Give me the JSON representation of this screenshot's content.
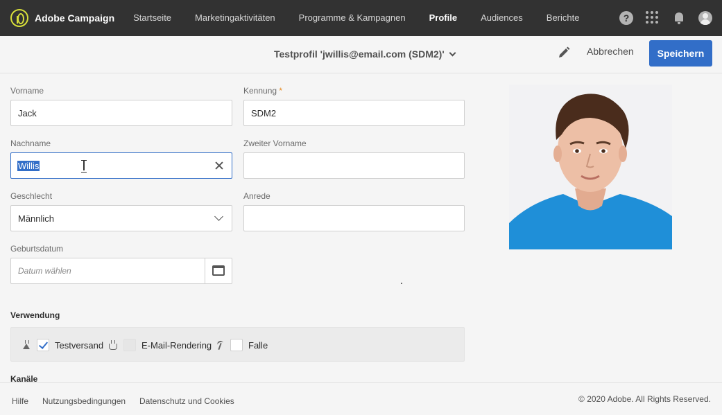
{
  "app": {
    "name": "Adobe Campaign"
  },
  "nav": {
    "items": [
      "Startseite",
      "Marketingaktivitäten",
      "Programme & Kampagnen",
      "Profile",
      "Audiences",
      "Berichte"
    ],
    "active_index": 3,
    "icons": [
      "help-icon",
      "apps-icon",
      "bell-icon",
      "avatar-icon"
    ],
    "help_glyph": "?"
  },
  "toolbar": {
    "title": "Testprofil 'jwillis@email.com (SDM2)'",
    "cancel_label": "Abbrechen",
    "save_label": "Speichern"
  },
  "form": {
    "vorname": {
      "label": "Vorname",
      "value": "Jack"
    },
    "kennung": {
      "label": "Kennung",
      "required_mark": "*",
      "value": "SDM2"
    },
    "nachname": {
      "label": "Nachname",
      "value": "Willis"
    },
    "zweiter_vorname": {
      "label": "Zweiter Vorname",
      "value": ""
    },
    "geschlecht": {
      "label": "Geschlecht",
      "value": "Männlich"
    },
    "anrede": {
      "label": "Anrede",
      "value": ""
    },
    "geburtsdatum": {
      "label": "Geburtsdatum",
      "placeholder": "Datum wählen"
    }
  },
  "usage": {
    "title": "Verwendung",
    "items": [
      {
        "label": "Testversand",
        "checked": true,
        "icon": "flask-icon"
      },
      {
        "label": "E-Mail-Rendering",
        "checked": false,
        "icon": "flask-check-icon"
      },
      {
        "label": "Falle",
        "checked": false,
        "icon": "trap-icon"
      }
    ]
  },
  "channels": {
    "title": "Kanäle"
  },
  "footer": {
    "links": [
      "Hilfe",
      "Nutzungsbedingungen",
      "Datenschutz und Cookies"
    ],
    "copyright": "© 2020 Adobe. All Rights Reserved."
  },
  "colors": {
    "nav_bg": "#323232",
    "accent": "#326ec8",
    "brand": "#d7de3a",
    "shirt": "#1f8fd8"
  }
}
